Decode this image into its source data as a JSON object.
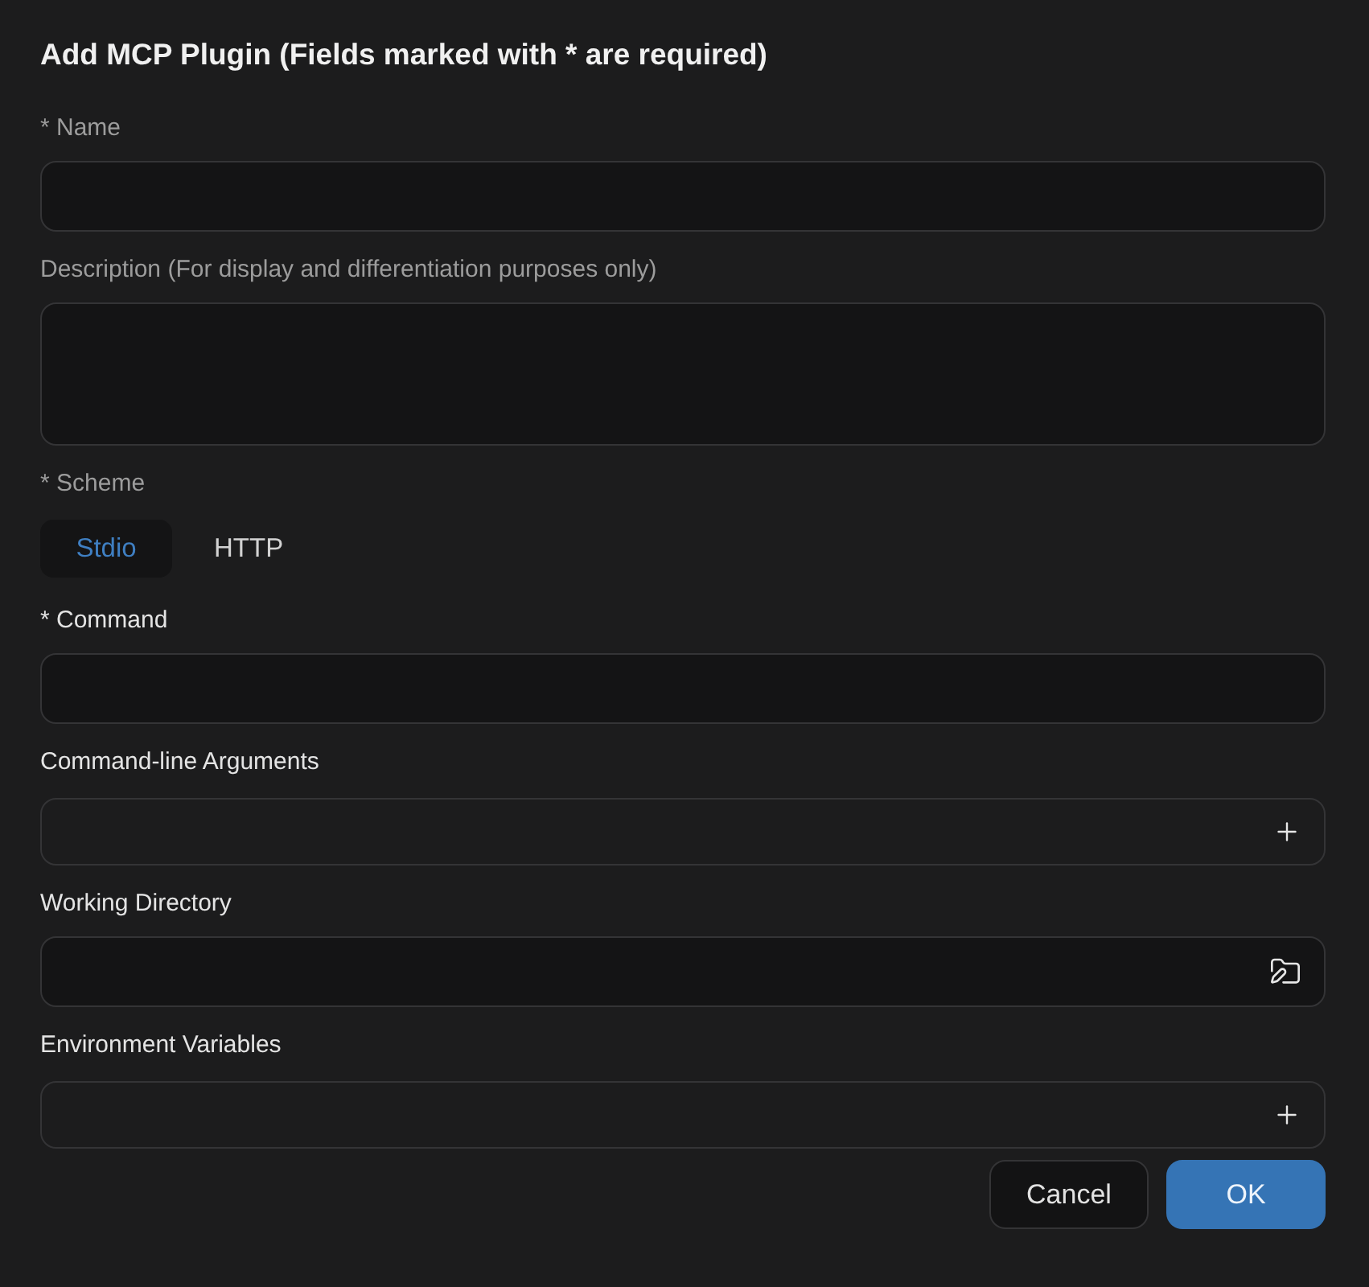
{
  "dialog": {
    "title": "Add MCP Plugin (Fields marked with * are required)"
  },
  "fields": [
    {
      "kind": "text",
      "label": "* Name",
      "highlighted": false
    },
    {
      "kind": "textarea",
      "label": "Description (For display and differentiation purposes only)",
      "highlighted": false
    },
    {
      "kind": "segmented",
      "label": "* Scheme",
      "highlighted": false,
      "options": [
        {
          "label": "Stdio",
          "selected": true
        },
        {
          "label": "HTTP",
          "selected": false
        }
      ]
    },
    {
      "kind": "text",
      "label": "* Command",
      "highlighted": true
    },
    {
      "kind": "list",
      "label": "Command-line Arguments",
      "highlighted": true
    },
    {
      "kind": "folder",
      "label": "Working Directory",
      "highlighted": true
    },
    {
      "kind": "list",
      "label": "Environment Variables",
      "highlighted": true
    }
  ],
  "buttons": [
    {
      "label": "Cancel",
      "kind": "secondary"
    },
    {
      "label": "OK",
      "kind": "primary"
    }
  ]
}
